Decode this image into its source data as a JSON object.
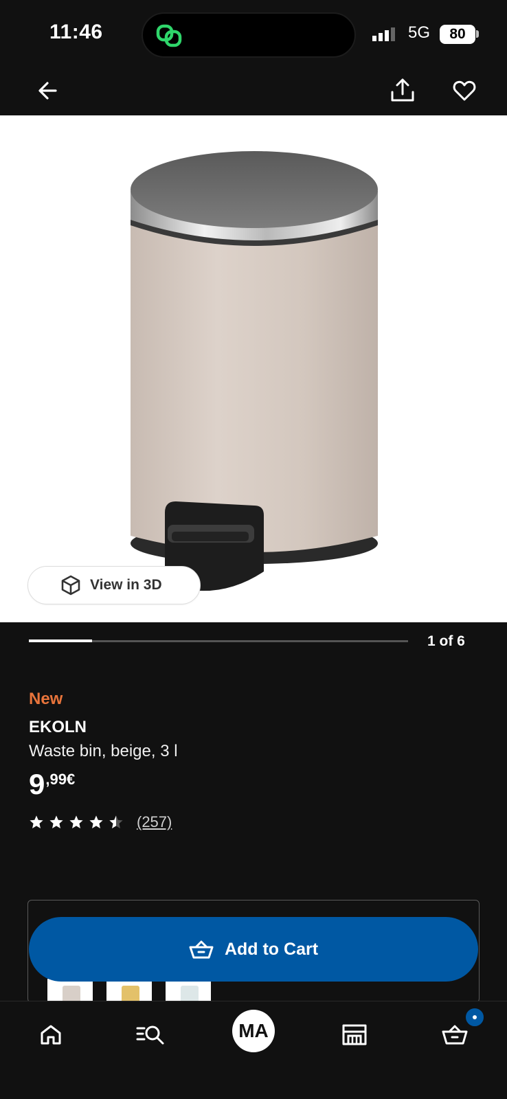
{
  "status_bar": {
    "time": "11:46",
    "network": "5G",
    "battery": "80",
    "app_icon": "link-chain-icon",
    "signal_icon": "signal-bars-icon"
  },
  "top_nav": {
    "back_icon": "arrow-left-icon",
    "share_icon": "share-icon",
    "favorite_icon": "heart-icon"
  },
  "media": {
    "view_3d_label": "View in 3D",
    "view_3d_icon": "cube-icon",
    "pager_text": "1 of 6",
    "progress_fraction": 0.1667
  },
  "product": {
    "badge": "New",
    "name": "EKOLN",
    "description": "Waste bin, beige, 3 l",
    "price_main": "9",
    "price_decimals": ",99€",
    "rating": 4.5,
    "rating_max": 5,
    "review_count": "(257)"
  },
  "variants": {
    "swatch_colors": [
      "#d8cfc8",
      "#e3c16a",
      "#dde7e8"
    ]
  },
  "cart": {
    "label": "Add to Cart",
    "icon": "basket-icon",
    "has_items_indicator": true
  },
  "tabbar": {
    "items": [
      {
        "icon": "home-icon"
      },
      {
        "icon": "search-list-icon"
      },
      {
        "avatar_initials": "MA"
      },
      {
        "icon": "store-icon"
      },
      {
        "icon": "basket-icon"
      }
    ]
  },
  "colors": {
    "accent_blue": "#0058a3",
    "badge_orange": "#e8743b",
    "background": "#111111",
    "product_beige": "#d5c9c0"
  }
}
